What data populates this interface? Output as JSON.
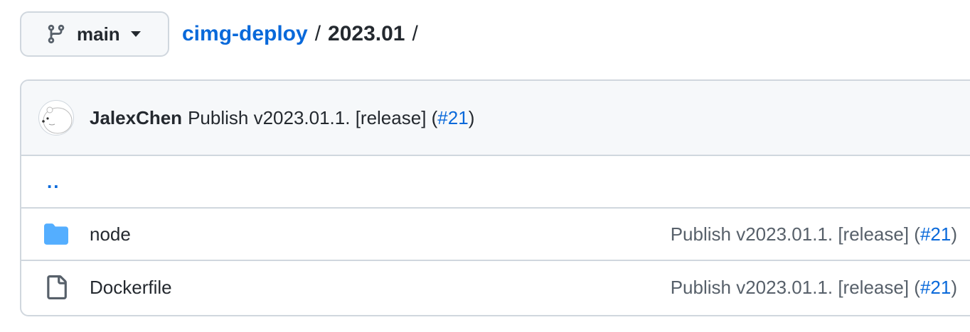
{
  "branch": {
    "label": "main",
    "icon": "git-branch-icon"
  },
  "breadcrumb": {
    "repo": "cimg-deploy",
    "separator": "/",
    "dir": "2023.01",
    "trailing": "/"
  },
  "latest_commit": {
    "author": "JalexChen",
    "message": "Publish v2023.01.1. [release] (",
    "pr": "#21",
    "close": ")"
  },
  "parent_dir": {
    "label": ".."
  },
  "files": [
    {
      "type": "folder",
      "name": "node",
      "commit_message": "Publish v2023.01.1. [release] (",
      "commit_pr": "#21",
      "commit_close": ")"
    },
    {
      "type": "file",
      "name": "Dockerfile",
      "commit_message": "Publish v2023.01.1. [release] (",
      "commit_pr": "#21",
      "commit_close": ")"
    }
  ],
  "colors": {
    "link": "#0969da",
    "folder": "#54aeff",
    "border": "#d0d7de",
    "header_bg": "#f6f8fa",
    "muted": "#57606a"
  }
}
